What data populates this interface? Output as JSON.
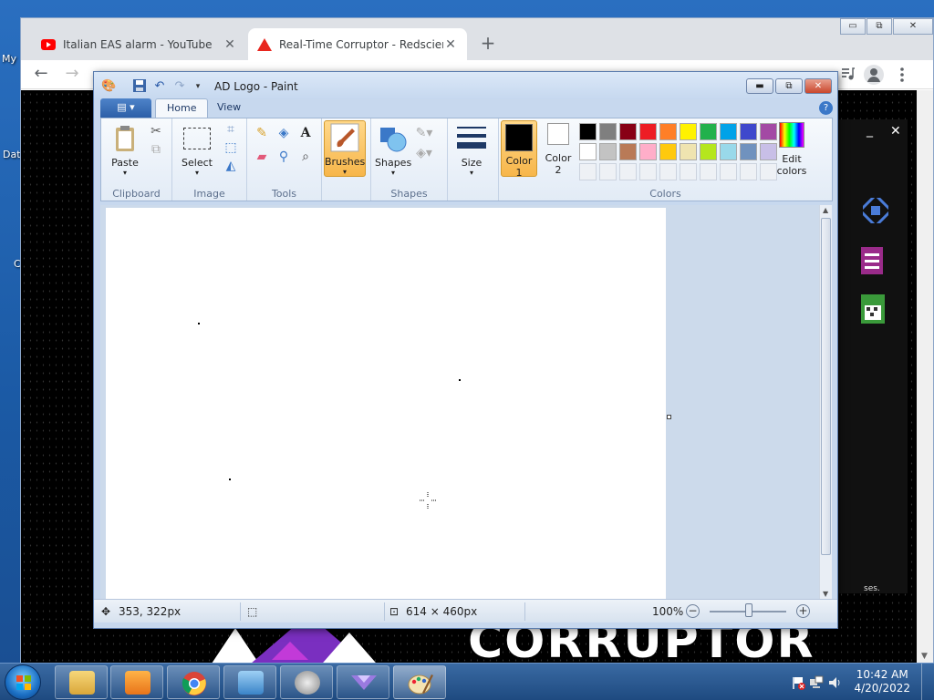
{
  "desktop": {
    "icon_labels": [
      "My",
      "Dat",
      "C"
    ]
  },
  "chrome": {
    "tabs": [
      {
        "title": "Italian EAS alarm - YouTube",
        "favicon": "youtube-icon",
        "close": "✕"
      },
      {
        "title": "Real-Time Corruptor - Redscientist",
        "favicon": "redscientist-icon",
        "close": "✕"
      }
    ],
    "new_tab": "+",
    "window_controls": {
      "minimize": "▭",
      "restore": "⧉",
      "close": "✕"
    },
    "nav": {
      "back": "←",
      "forward": "→"
    },
    "page": {
      "logo_text": "CORRUPTOR",
      "panel_buttons": {
        "minimize": "_",
        "close": "✕"
      },
      "side_text": "ses."
    }
  },
  "paint": {
    "title": "AD Logo - Paint",
    "quick_access": [
      "save-icon",
      "undo-icon",
      "redo-icon",
      "customize-icon"
    ],
    "window_controls": {
      "minimize": "▬",
      "restore": "⧉",
      "close": "✕"
    },
    "tabs": {
      "file": "▤ ▾",
      "home": "Home",
      "view": "View"
    },
    "help": "?",
    "groups": {
      "clipboard": {
        "label": "Clipboard",
        "paste": "Paste"
      },
      "image": {
        "label": "Image",
        "select": "Select"
      },
      "tools": {
        "label": "Tools"
      },
      "brushes": {
        "label": "Brushes"
      },
      "shapes": {
        "label": "Shapes",
        "shapes_btn": "Shapes"
      },
      "size": {
        "label": "Size"
      },
      "colors": {
        "label": "Colors",
        "color1_line1": "Color",
        "color1_line2": "1",
        "color2_line1": "Color",
        "color2_line2": "2",
        "edit_line1": "Edit",
        "edit_line2": "colors",
        "color1": "#000000",
        "color2": "#ffffff",
        "palette_row1": [
          "#000000",
          "#7f7f7f",
          "#880015",
          "#ed1c24",
          "#ff7f27",
          "#fff200",
          "#22b14c",
          "#00a2e8",
          "#3f48cc",
          "#a349a4"
        ],
        "palette_row2": [
          "#ffffff",
          "#c3c3c3",
          "#b97a57",
          "#ffaec9",
          "#ffc90e",
          "#efe4b0",
          "#b5e61d",
          "#99d9ea",
          "#7092be",
          "#c8bfe7"
        ]
      }
    },
    "status": {
      "cursor_pos": "353, 322px",
      "selection": "",
      "canvas_size": "614 × 460px",
      "zoom": "100%",
      "zoom_out": "−",
      "zoom_in": "+"
    }
  },
  "taskbar": {
    "items": [
      "explorer-icon",
      "media-player-icon",
      "chrome-icon",
      "control-panel-icon",
      "audio-icon",
      "app-icon",
      "paint-icon"
    ],
    "clock_time": "10:42 AM",
    "clock_date": "4/20/2022"
  }
}
